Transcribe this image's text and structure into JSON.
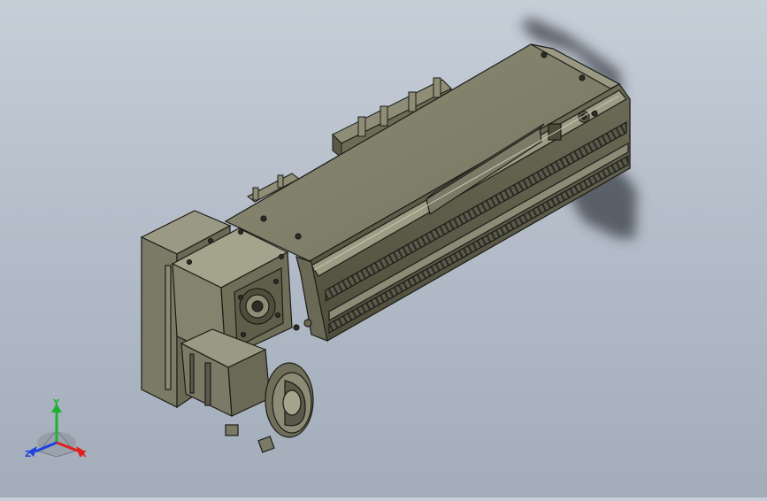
{
  "viewport": {
    "background_top": "#c6ced8",
    "background_bottom": "#a3adba"
  },
  "model": {
    "body_color": "#7b7a66",
    "body_light": "#9a9983",
    "body_dark": "#55543f",
    "edge_color": "#1c1c18",
    "shadow_color": "#3b3f46"
  },
  "triad": {
    "x_label": "X",
    "y_label": "Y",
    "z_label": "Z",
    "x_color": "#e02020",
    "y_color": "#20b030",
    "z_color": "#2040e0"
  }
}
